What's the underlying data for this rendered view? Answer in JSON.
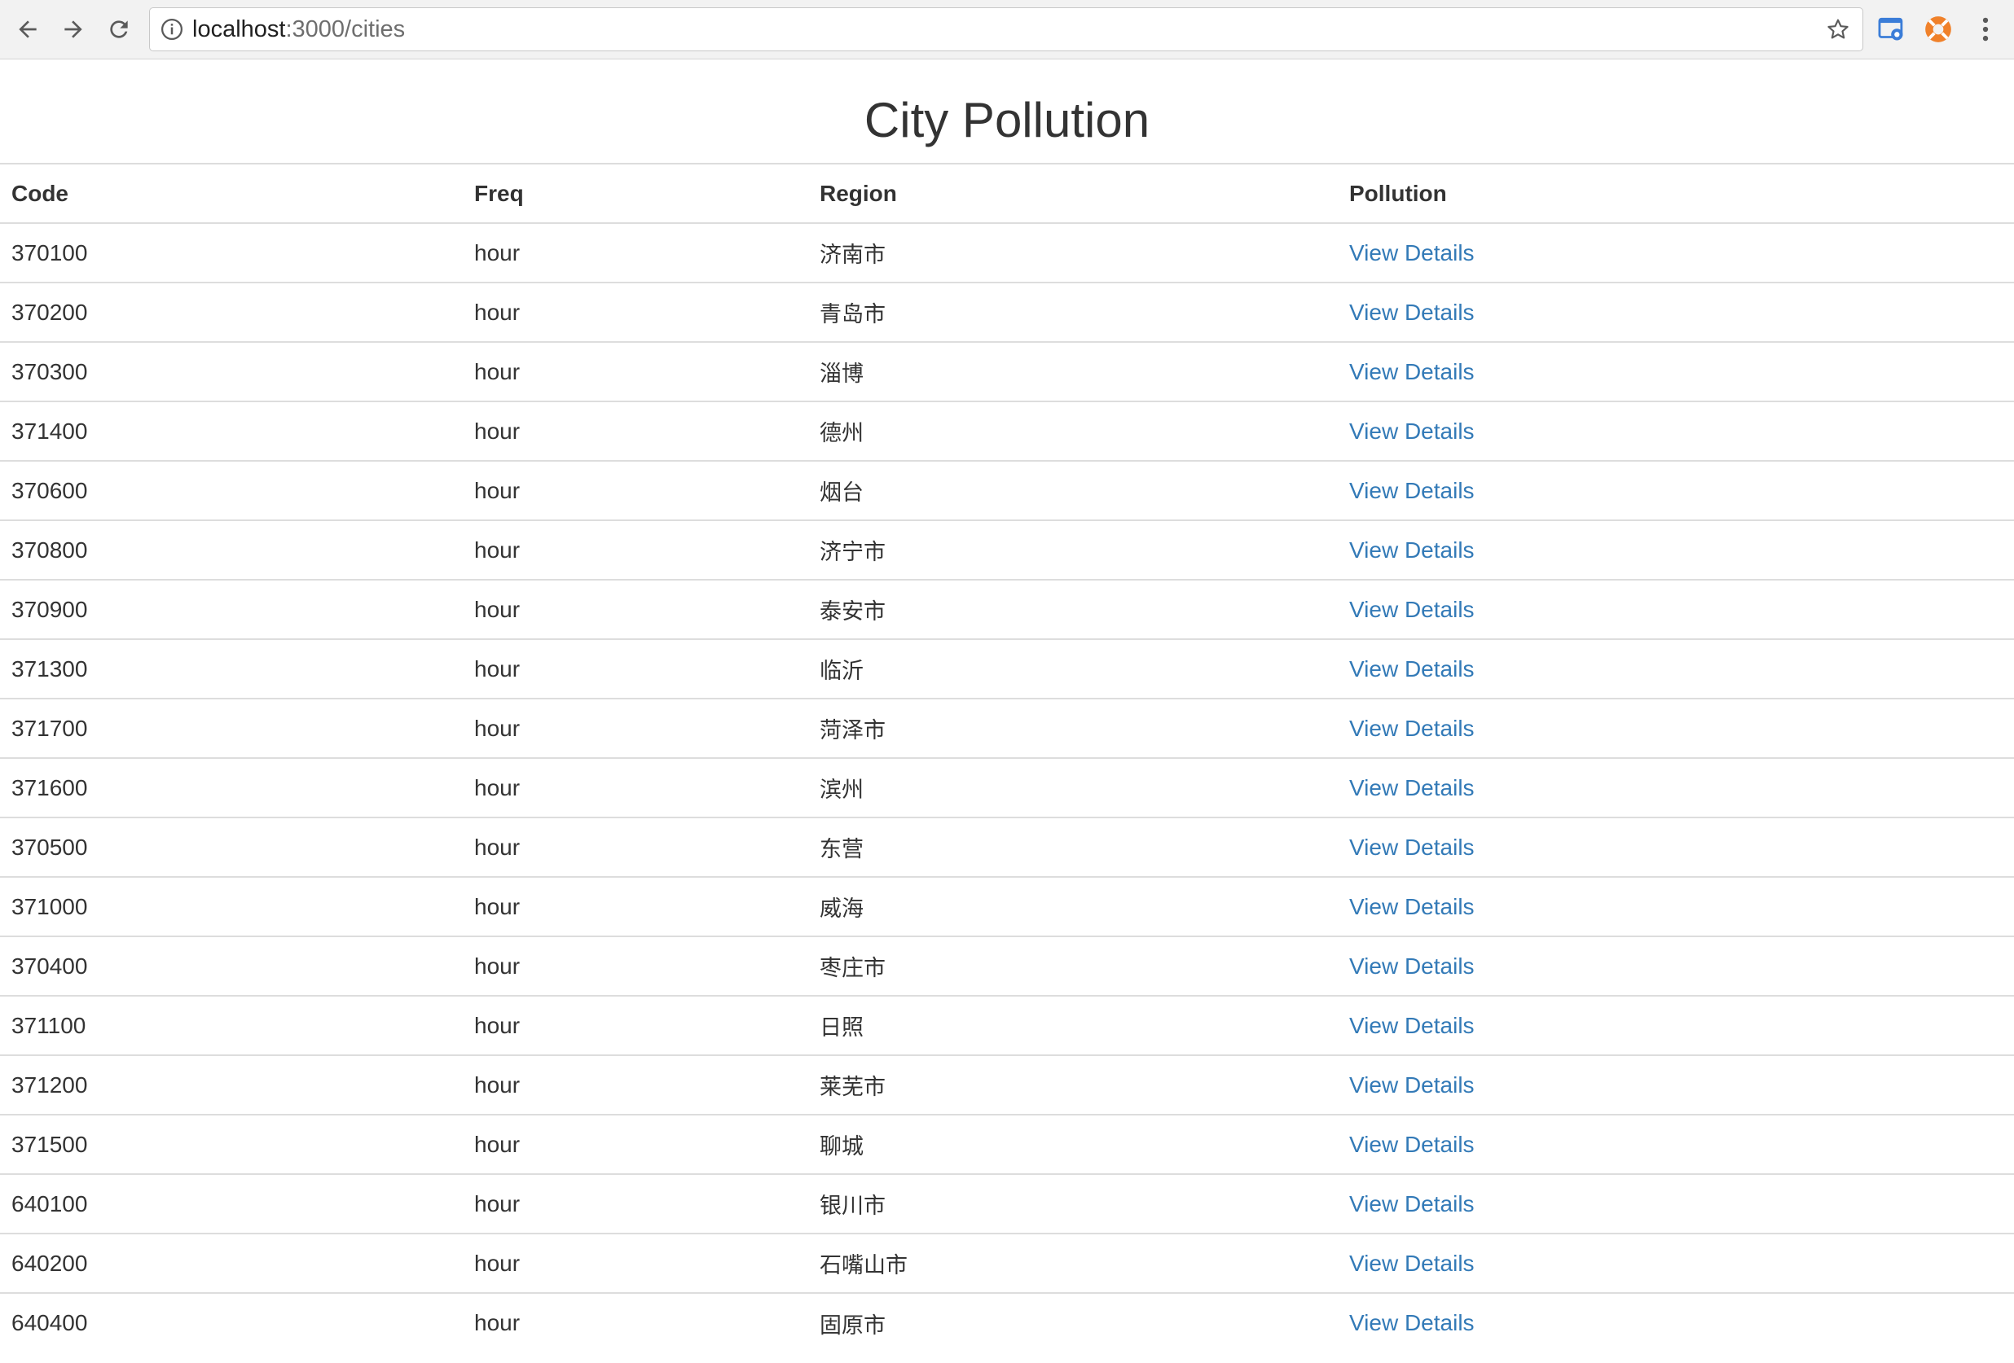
{
  "browser": {
    "url_host": "localhost",
    "url_rest": ":3000/cities"
  },
  "page": {
    "title": "City Pollution"
  },
  "table": {
    "headers": {
      "code": "Code",
      "freq": "Freq",
      "region": "Region",
      "pollution": "Pollution"
    },
    "rows": [
      {
        "code": "370100",
        "freq": "hour",
        "region": "济南市",
        "link": "View Details"
      },
      {
        "code": "370200",
        "freq": "hour",
        "region": "青岛市",
        "link": "View Details"
      },
      {
        "code": "370300",
        "freq": "hour",
        "region": "淄博",
        "link": "View Details"
      },
      {
        "code": "371400",
        "freq": "hour",
        "region": "德州",
        "link": "View Details"
      },
      {
        "code": "370600",
        "freq": "hour",
        "region": "烟台",
        "link": "View Details"
      },
      {
        "code": "370800",
        "freq": "hour",
        "region": "济宁市",
        "link": "View Details"
      },
      {
        "code": "370900",
        "freq": "hour",
        "region": "泰安市",
        "link": "View Details"
      },
      {
        "code": "371300",
        "freq": "hour",
        "region": "临沂",
        "link": "View Details"
      },
      {
        "code": "371700",
        "freq": "hour",
        "region": "菏泽市",
        "link": "View Details"
      },
      {
        "code": "371600",
        "freq": "hour",
        "region": "滨州",
        "link": "View Details"
      },
      {
        "code": "370500",
        "freq": "hour",
        "region": "东营",
        "link": "View Details"
      },
      {
        "code": "371000",
        "freq": "hour",
        "region": "威海",
        "link": "View Details"
      },
      {
        "code": "370400",
        "freq": "hour",
        "region": "枣庄市",
        "link": "View Details"
      },
      {
        "code": "371100",
        "freq": "hour",
        "region": "日照",
        "link": "View Details"
      },
      {
        "code": "371200",
        "freq": "hour",
        "region": "莱芜市",
        "link": "View Details"
      },
      {
        "code": "371500",
        "freq": "hour",
        "region": "聊城",
        "link": "View Details"
      },
      {
        "code": "640100",
        "freq": "hour",
        "region": "银川市",
        "link": "View Details"
      },
      {
        "code": "640200",
        "freq": "hour",
        "region": "石嘴山市",
        "link": "View Details"
      },
      {
        "code": "640400",
        "freq": "hour",
        "region": "固原市",
        "link": "View Details"
      }
    ]
  },
  "colors": {
    "link": "#337ab7",
    "text": "#333333",
    "border": "#dddddd",
    "ext_orange": "#f0812a"
  }
}
